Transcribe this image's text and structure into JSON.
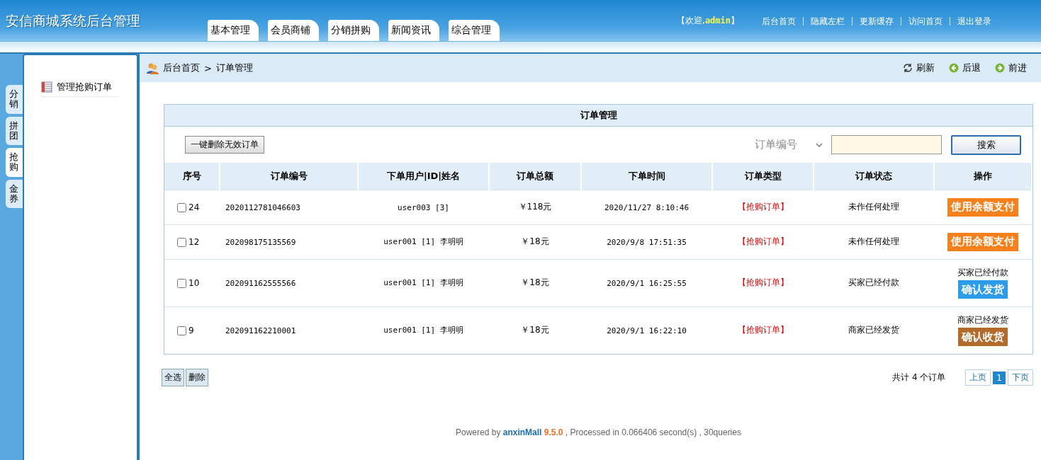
{
  "header": {
    "title": "安信商城系统后台管理",
    "nav_tabs": [
      {
        "label": "基本管理",
        "selected": false
      },
      {
        "label": "会员商铺",
        "selected": false
      },
      {
        "label": "分销拼购",
        "selected": false
      },
      {
        "label": "新闻资讯",
        "selected": false
      },
      {
        "label": "综合管理",
        "selected": false
      }
    ],
    "welcome": {
      "prefix": "【欢迎,",
      "user": "admin",
      "suffix": "】"
    },
    "links": [
      "后台首页",
      "隐藏左栏",
      "更新缓存",
      "访问首页",
      "退出登录"
    ]
  },
  "side_tabs": [
    {
      "label": "分销",
      "selected": false
    },
    {
      "label": "拼团",
      "selected": false
    },
    {
      "label": "抢购",
      "selected": true
    },
    {
      "label": "金券",
      "selected": false
    }
  ],
  "sidebar": {
    "items": [
      {
        "label": "管理抢购订单"
      }
    ]
  },
  "breadcrumb": {
    "items": [
      "后台首页",
      "订单管理"
    ],
    "separator": ">",
    "actions": [
      {
        "kind": "refresh",
        "label": "刷新"
      },
      {
        "kind": "back",
        "label": "后退"
      },
      {
        "kind": "forward",
        "label": "前进"
      }
    ]
  },
  "panel": {
    "title": "订单管理",
    "delete_invalid_button": "一键删除无效订单",
    "search": {
      "field": "订单编号",
      "button": "搜索"
    }
  },
  "table": {
    "columns": [
      "序号",
      "订单编号",
      "下单用户|ID|姓名",
      "订单总额",
      "下单时间",
      "订单类型",
      "订单状态",
      "操作"
    ],
    "rows": [
      {
        "checked": false,
        "no": "24",
        "order_no": "2020112781046603",
        "user": "user003 [3]",
        "total": "￥118元",
        "time": "2020/11/27 8:10:46",
        "type": "【抢购订单】",
        "status": "未作任何处理",
        "action": {
          "kind": "pay",
          "label": "使用余额支付"
        }
      },
      {
        "checked": false,
        "no": "12",
        "order_no": "202098175135569",
        "user": "user001 [1] 李明明",
        "total": "￥18元",
        "time": "2020/9/8 17:51:35",
        "type": "【抢购订单】",
        "status": "未作任何处理",
        "action": {
          "kind": "pay",
          "label": "使用余额支付"
        }
      },
      {
        "checked": false,
        "no": "10",
        "order_no": "202091162555566",
        "user": "user001 [1] 李明明",
        "total": "￥18元",
        "time": "2020/9/1 16:25:55",
        "type": "【抢购订单】",
        "status": "买家已经付款",
        "action": {
          "kind": "ship",
          "note": "买家已经付款",
          "label": "确认发货"
        }
      },
      {
        "checked": false,
        "no": "9",
        "order_no": "202091162210001",
        "user": "user001 [1] 李明明",
        "total": "￥18元",
        "time": "2020/9/1 16:22:10",
        "type": "【抢购订单】",
        "status": "商家已经发货",
        "action": {
          "kind": "receive",
          "note": "商家已经发货",
          "label": "确认收货"
        }
      }
    ]
  },
  "bottom_buttons": [
    "全选",
    "删除"
  ],
  "pagination": {
    "summary": "共计 4 个订单",
    "prev": "上页",
    "pages": [
      {
        "label": "1",
        "selected": true
      }
    ],
    "next": "下页"
  },
  "footer": {
    "prefix": "Powered by",
    "brand": "anxinMall",
    "version": "9.5.0",
    "suffix": ", Processed in 0.066406 second(s) , 30queries"
  }
}
